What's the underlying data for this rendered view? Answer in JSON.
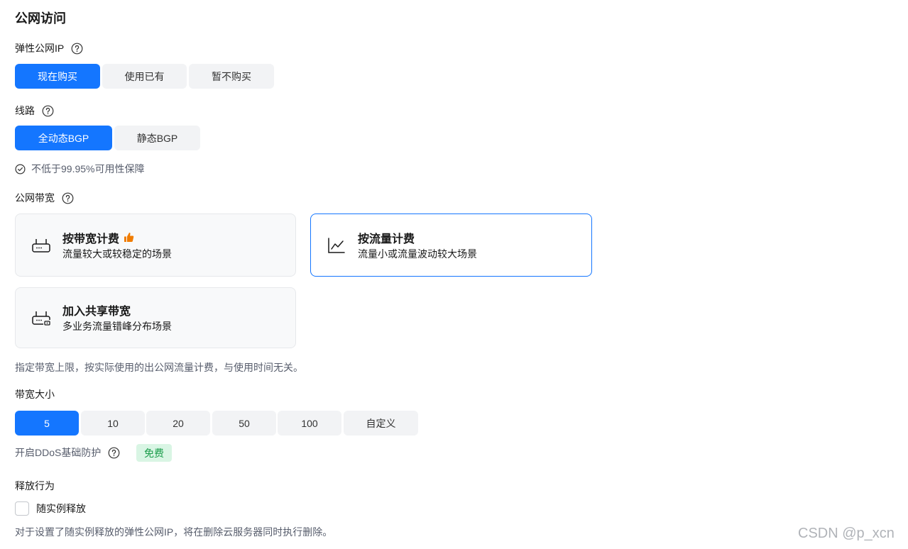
{
  "section": {
    "title": "公网访问"
  },
  "eip": {
    "label": "弹性公网IP",
    "options": [
      "现在购买",
      "使用已有",
      "暂不购买"
    ],
    "selected": "现在购买"
  },
  "line": {
    "label": "线路",
    "options": [
      "全动态BGP",
      "静态BGP"
    ],
    "selected": "全动态BGP",
    "guarantee": "不低于99.95%可用性保障"
  },
  "bandwidth": {
    "label": "公网带宽",
    "cards": [
      {
        "title": "按带宽计费",
        "desc": "流量较大或较稳定的场景",
        "icon": "router-icon",
        "recommended": true
      },
      {
        "title": "按流量计费",
        "desc": "流量小或流量波动较大场景",
        "icon": "line-chart-icon",
        "selected": true
      },
      {
        "title": "加入共享带宽",
        "desc": "多业务流量错峰分布场景",
        "icon": "shared-router-icon"
      }
    ],
    "hint": "指定带宽上限，按实际使用的出公网流量计费，与使用时间无关。"
  },
  "size": {
    "label": "带宽大小",
    "options": [
      "5",
      "10",
      "20",
      "50",
      "100",
      "自定义"
    ],
    "selected": "5"
  },
  "ddos": {
    "label": "开启DDoS基础防护",
    "badge": "免费"
  },
  "release": {
    "label": "释放行为",
    "checkbox_label": "随实例释放",
    "checked": false,
    "hint": "对于设置了随实例释放的弹性公网IP，将在删除云服务器同时执行删除。"
  },
  "watermark": "CSDN @p_xcn",
  "colors": {
    "accent": "#1476ff",
    "free_bg": "#d9f5e4",
    "free_text": "#1a9c4a",
    "thumb": "#f07c00"
  }
}
